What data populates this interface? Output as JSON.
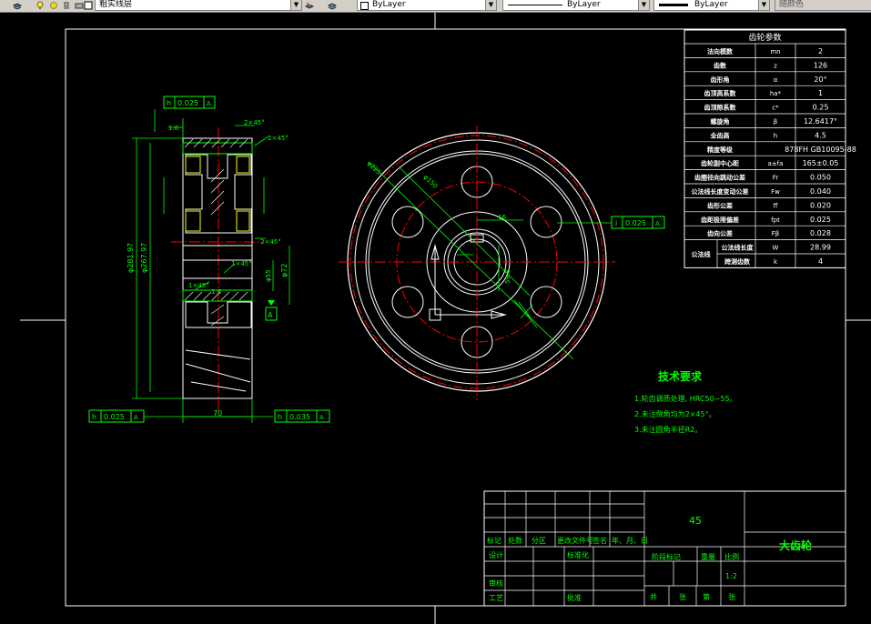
{
  "toolbar": {
    "layer_name": "粗实线层",
    "color_value": "ByLayer",
    "linetype_value": "ByLayer",
    "lineweight_value": "ByLayer",
    "plot_style": "随颜色"
  },
  "params_table": {
    "title": "齿轮参数",
    "rows": [
      {
        "name": "法向模数",
        "symbol": "mn",
        "value": "2"
      },
      {
        "name": "齿数",
        "symbol": "z",
        "value": "126"
      },
      {
        "name": "齿形角",
        "symbol": "α",
        "value": "20°"
      },
      {
        "name": "齿顶高系数",
        "symbol": "ha*",
        "value": "1"
      },
      {
        "name": "齿顶隙系数",
        "symbol": "c*",
        "value": "0.25"
      },
      {
        "name": "螺旋角",
        "symbol": "β",
        "value": "12.6417°"
      },
      {
        "name": "全齿高",
        "symbol": "h",
        "value": "4.5"
      },
      {
        "name": "精度等级",
        "symbol": "",
        "value": "878FH GB10095-88"
      },
      {
        "name": "齿轮副中心距",
        "symbol": "a±fa",
        "value": "165±0.05"
      },
      {
        "name": "齿圈径向跳动公差",
        "symbol": "Fr",
        "value": "0.050"
      },
      {
        "name": "公法线长度变动公差",
        "symbol": "Fw",
        "value": "0.040"
      },
      {
        "name": "齿形公差",
        "symbol": "ff",
        "value": "0.020"
      },
      {
        "name": "齿距极限偏差",
        "symbol": "fpt",
        "value": "0.025"
      },
      {
        "name": "齿向公差",
        "symbol": "Fβ",
        "value": "0.028"
      }
    ],
    "group_label": "公法线",
    "group_rows": [
      {
        "name": "公法线长度",
        "symbol": "W",
        "value": "28.99"
      },
      {
        "name": "跨测齿数",
        "symbol": "k",
        "value": "4"
      }
    ]
  },
  "tech_requirements": {
    "title": "技术要求",
    "items": [
      "1.轮齿调质处理, HRC50~55。",
      "2.未注倒角均为2×45°。",
      "3.未注圆角半径R2。"
    ]
  },
  "title_block": {
    "material": "45",
    "part_name": "大齿轮",
    "col_headers": [
      "标记",
      "处数",
      "分区",
      "更改文件号",
      "签名",
      "年、月、日"
    ],
    "row_design": "设计",
    "row_standard": "标准化",
    "row_review": "审核",
    "row_process": "工艺",
    "row_approve": "批准",
    "stage_label": "阶段标记",
    "weight_label": "重量",
    "scale_label": "比例",
    "scale_value": "1:2",
    "sheet_labels": [
      "共",
      "张",
      "第",
      "张"
    ]
  },
  "dimensions": {
    "tol_top": "0.025",
    "tol_top_letter": "A",
    "tol_bot_left": "0.025",
    "tol_bot_right": "0.035",
    "tol_mid": "0.025",
    "tol_letter_h": "h",
    "tol_letter_i": "i",
    "width_70": "70",
    "chamfer_top": "2×45°",
    "chamfer_top2": "2×45°",
    "chamfer_mid": "2×45°",
    "chamfer_small": "1×45°",
    "chamfer_small2": "1×45°",
    "dim_16": "1.6",
    "dim_16b": "1.6",
    "dia_left1": "φ281.97",
    "dia_left2": "φ267.97",
    "dia_hub": "φ72",
    "dia_bore": "φ55",
    "dim_c1": "φ225",
    "dim_c2": "φ150",
    "key_width": "16",
    "key_depth": "59.3",
    "datum_a": "A"
  }
}
